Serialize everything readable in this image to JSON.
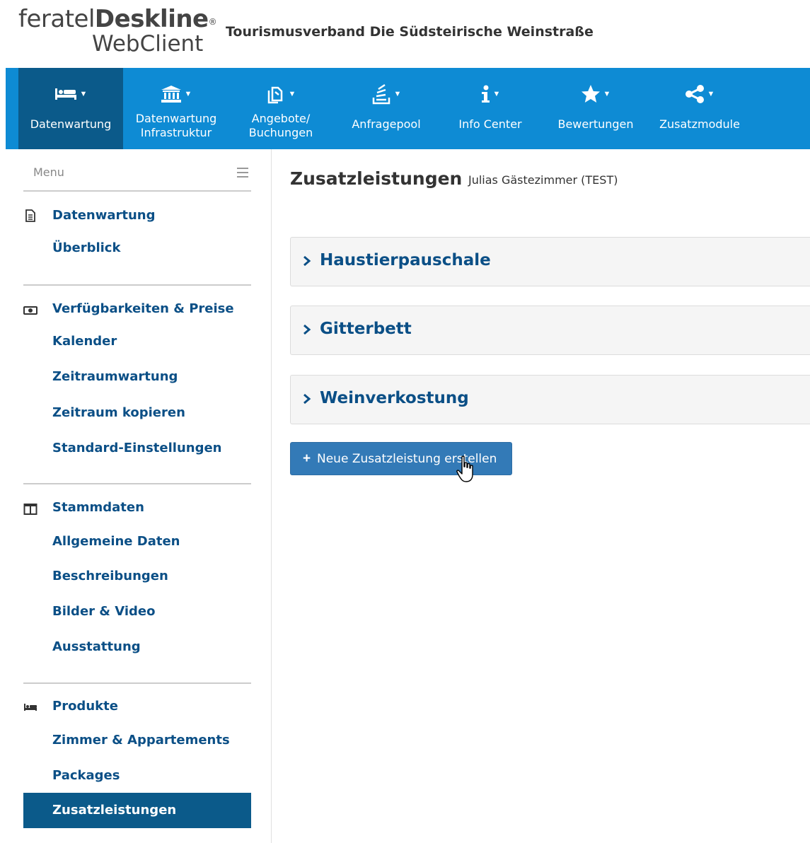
{
  "header": {
    "logo_part1": "feratel",
    "logo_part2": "Deskline",
    "logo_reg": "®",
    "logo_line2": "WebClient",
    "org_name": "Tourismusverband Die Südsteirische Weinstraße"
  },
  "nav": {
    "items": [
      {
        "line1": "Datenwartung",
        "line2": "",
        "icon": "bed-icon",
        "active": true
      },
      {
        "line1": "Datenwartung",
        "line2": "Infrastruktur",
        "icon": "bank-icon",
        "active": false
      },
      {
        "line1": "Angebote/",
        "line2": "Buchungen",
        "icon": "documents-icon",
        "active": false
      },
      {
        "line1": "Anfragepool",
        "line2": "",
        "icon": "inbox-stack-icon",
        "active": false
      },
      {
        "line1": "Info Center",
        "line2": "",
        "icon": "info-icon",
        "active": false
      },
      {
        "line1": "Bewertungen",
        "line2": "",
        "icon": "star-icon",
        "active": false
      },
      {
        "line1": "Zusatzmodule",
        "line2": "",
        "icon": "share-icon",
        "active": false
      }
    ]
  },
  "sidebar": {
    "menu_label": "Menu",
    "sections": [
      {
        "title": "Datenwartung",
        "icon": "document-icon",
        "links": [
          "Überblick"
        ]
      },
      {
        "title": "Verfügbarkeiten & Preise",
        "icon": "money-icon",
        "links": [
          "Kalender",
          "Zeitraumwartung",
          "Zeitraum kopieren",
          "Standard-Einstellungen"
        ]
      },
      {
        "title": "Stammdaten",
        "icon": "columns-icon",
        "links": [
          "Allgemeine Daten",
          "Beschreibungen",
          "Bilder & Video",
          "Ausstattung"
        ]
      },
      {
        "title": "Produkte",
        "icon": "bed-icon",
        "links": [
          "Zimmer & Appartements",
          "Packages",
          "Zusatzleistungen"
        ]
      }
    ],
    "active_link": "Zusatzleistungen"
  },
  "main": {
    "title": "Zusatzleistungen",
    "subtitle": "Julias Gästezimmer (TEST)",
    "panels": [
      "Haustierpauschale",
      "Gitterbett",
      "Weinverkostung"
    ],
    "new_button_label": "Neue Zusatzleistung erstellen"
  },
  "colors": {
    "nav_bg": "#0e8bd4",
    "nav_active": "#0b5a8a",
    "link": "#0b4f86",
    "button": "#337ab7"
  }
}
